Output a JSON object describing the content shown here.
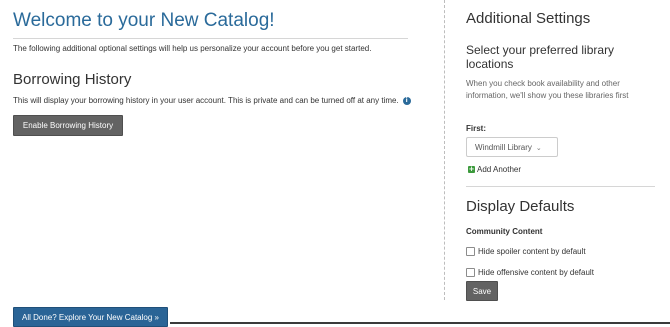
{
  "main": {
    "title": "Welcome to your New Catalog!",
    "intro": "The following additional optional settings will help us personalize your account before you get started.",
    "borrowing": {
      "title": "Borrowing History",
      "description": "This will display your borrowing history in your user account. This is private and can be turned off at any time.",
      "info_icon": "info-circle-icon",
      "button_label": "Enable Borrowing History"
    },
    "done_button_label": "All Done? Explore Your New Catalog »"
  },
  "sidebar": {
    "title": "Additional Settings",
    "locations": {
      "title": "Select your preferred library locations",
      "help": "When you check book availability and other information, we'll show you these libraries first",
      "first_label": "First:",
      "first_value": "Windmill Library",
      "chevron_icon": "chevron-down-icon",
      "add_icon": "plus-square-icon",
      "add_label": "Add Another"
    },
    "display": {
      "title": "Display Defaults",
      "community_label": "Community Content",
      "options": [
        {
          "label": "Hide spoiler content by default",
          "checked": false
        },
        {
          "label": "Hide offensive content by default",
          "checked": false
        }
      ],
      "save_label": "Save"
    }
  },
  "colors": {
    "title_blue": "#2a6a9a",
    "primary_button": "#2a6496",
    "dark_button": "#636363",
    "add_green": "#3c9a3c"
  }
}
